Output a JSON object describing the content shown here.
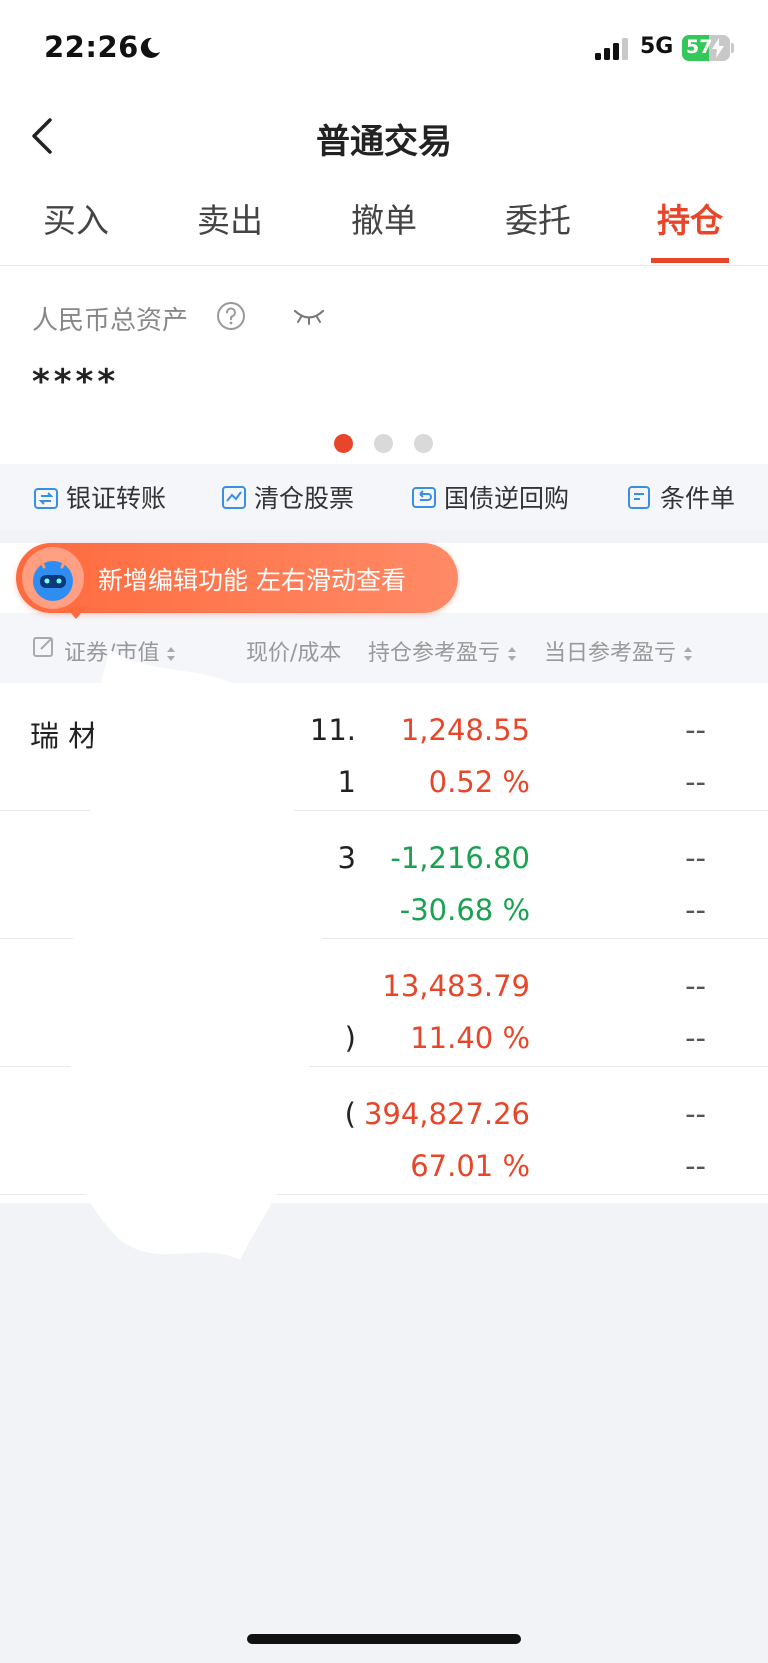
{
  "status_bar": {
    "time": "22:26",
    "network": "5G",
    "battery": "57",
    "battery_level": 0.57
  },
  "nav": {
    "title": "普通交易"
  },
  "tabs": [
    {
      "label": "买入"
    },
    {
      "label": "卖出"
    },
    {
      "label": "撤单"
    },
    {
      "label": "委托"
    },
    {
      "label": "持仓"
    }
  ],
  "asset": {
    "label": "人民币总资产",
    "value": "****"
  },
  "tools": [
    {
      "label": "银证转账",
      "icon": "transfer-icon"
    },
    {
      "label": "清仓股票",
      "icon": "clear-stock-icon"
    },
    {
      "label": "国债逆回购",
      "icon": "repo-icon"
    },
    {
      "label": "条件单",
      "icon": "condition-order-icon"
    }
  ],
  "tooltip": {
    "text": "新增编辑功能 左右滑动查看"
  },
  "table": {
    "headers": {
      "security": "证券",
      "market_value": "市值",
      "price_cost": "现价/成本",
      "position_pl": "持仓参考盈亏",
      "today_pl": "当日参考盈亏"
    },
    "rows": [
      {
        "name": "瑞  材",
        "price": "11.",
        "cost": "1",
        "pl": "1,248.55",
        "pl_pct": "0.52 %",
        "day_pl": "--",
        "day_pct": "--",
        "trend": "up"
      },
      {
        "name": "",
        "price": "3",
        "cost": "",
        "pl": "-1,216.80",
        "pl_pct": "-30.68 %",
        "day_pl": "--",
        "day_pct": "--",
        "trend": "down"
      },
      {
        "name": "",
        "price": "",
        "cost": ")",
        "pl": "13,483.79",
        "pl_pct": "11.40 %",
        "day_pl": "--",
        "day_pct": "--",
        "trend": "up"
      },
      {
        "name": "",
        "price": "(",
        "cost": "",
        "pl": "394,827.26",
        "pl_pct": "67.01 %",
        "day_pl": "--",
        "day_pct": "--",
        "trend": "up"
      }
    ]
  },
  "colors": {
    "accent": "#e8462a",
    "gain": "#e8462a",
    "loss": "#1aa250",
    "tool_icon": "#3a8ee6"
  }
}
